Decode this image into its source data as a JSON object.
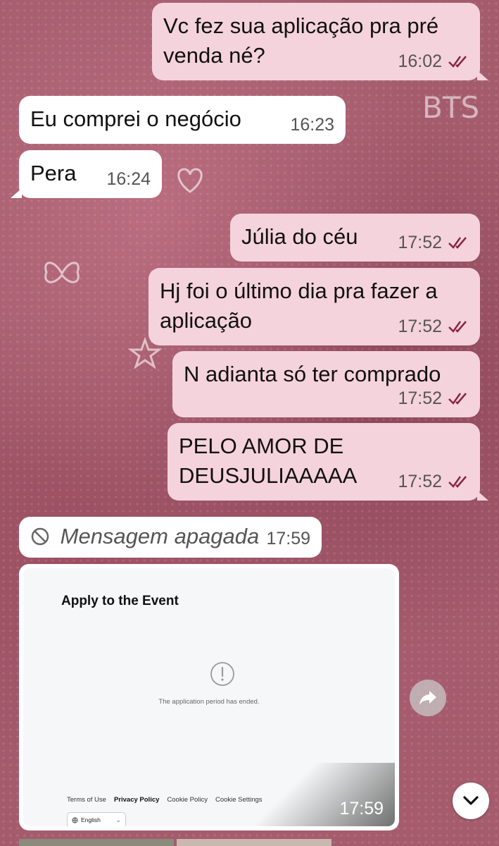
{
  "messages": [
    {
      "direction": "out",
      "text": "Vc fez sua aplicação pra pré venda né?",
      "time": "16:02"
    },
    {
      "direction": "in",
      "text": "Eu comprei o negócio",
      "time": "16:23"
    },
    {
      "direction": "in",
      "text": "Pera",
      "time": "16:24"
    },
    {
      "direction": "out",
      "text": "Júlia do céu",
      "time": "17:52"
    },
    {
      "direction": "out",
      "text": "Hj foi o último dia pra fazer a aplicação",
      "time": "17:52"
    },
    {
      "direction": "out",
      "text": "N adianta só ter comprado",
      "time": "17:52"
    },
    {
      "direction": "out",
      "text": "PELO AMOR DE DEUSJULIAAAAA",
      "time": "17:52"
    },
    {
      "direction": "in",
      "text": "Mensagem apagada",
      "time": "17:59",
      "deleted": true
    }
  ],
  "wallpaper": {
    "doodle_text": "BTS"
  },
  "image_message": {
    "time": "17:59",
    "screenshot": {
      "title": "Apply to the Event",
      "status_text": "The application period has ended.",
      "footer_links": [
        "Terms of Use",
        "Privacy Policy",
        "Cookie Policy",
        "Cookie Settings"
      ],
      "language": "English"
    }
  },
  "colors": {
    "outgoing_bubble": "#f5d3dc",
    "incoming_bubble": "#ffffff",
    "read_ticks": "#8a2440",
    "wallpaper": "#a45c6d"
  },
  "icons": {
    "read_receipt": "double-check-icon",
    "deleted": "prohibited-icon",
    "forward": "forward-icon",
    "scroll_down": "chevron-down-icon",
    "alert": "exclamation-circle-icon",
    "globe": "globe-icon"
  }
}
